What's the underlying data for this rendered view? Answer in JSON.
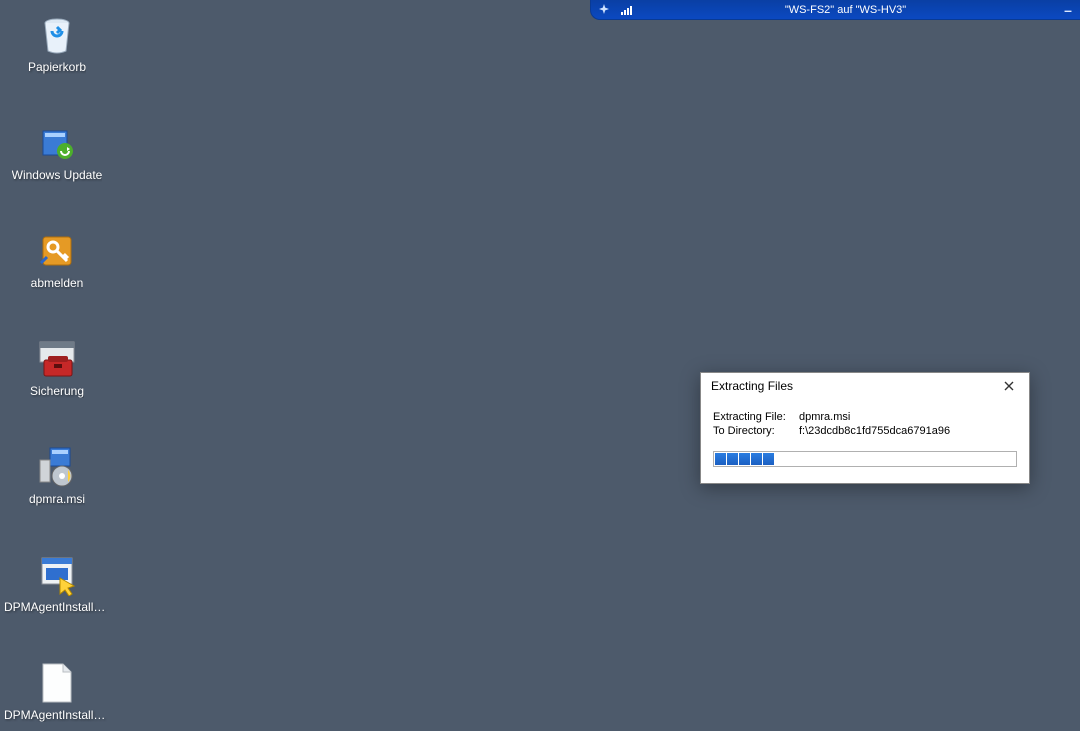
{
  "connbar": {
    "title": "\"WS-FS2\" auf \"WS-HV3\""
  },
  "icons": [
    {
      "name": "recycle-bin",
      "label": "Papierkorb"
    },
    {
      "name": "windows-update",
      "label": "Windows Update"
    },
    {
      "name": "logoff",
      "label": "abmelden"
    },
    {
      "name": "backup",
      "label": "Sicherung"
    },
    {
      "name": "dpmra-msi",
      "label": "dpmra.msi"
    },
    {
      "name": "dpm-agent-installer-1",
      "label": "DPMAgentInstaller..."
    },
    {
      "name": "dpm-agent-installer-2",
      "label": "DPMAgentInstaller..."
    }
  ],
  "dialog": {
    "title": "Extracting Files",
    "rows": {
      "file_label": "Extracting File:",
      "file_value": "dpmra.msi",
      "dir_label": "To Directory:",
      "dir_value": "f:\\23dcdb8c1fd755dca6791a96"
    },
    "progress_segments": 5
  }
}
